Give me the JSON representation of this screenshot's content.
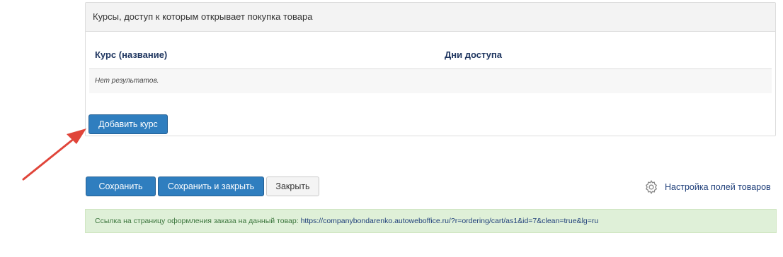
{
  "panel": {
    "title": "Курсы, доступ к которым открывает покупка товара",
    "table": {
      "columns": [
        "Курс (название)",
        "Дни доступа"
      ],
      "empty_text": "Нет результатов."
    },
    "add_button_label": "Добавить курс"
  },
  "actions": {
    "save_label": "Сохранить",
    "save_close_label": "Сохранить и закрыть",
    "close_label": "Закрыть"
  },
  "settings_link": {
    "label": "Настройка полей товаров",
    "icon": "gear-icon"
  },
  "info": {
    "prefix": "Ссылка на страницу оформления заказа на данный товар:",
    "url": "https://companybondarenko.autoweboffice.ru/?r=ordering/cart/as1&id=7&clean=true&lg=ru"
  },
  "colors": {
    "primary_button": "#2f7ebf",
    "arrow": "#e0453a",
    "info_background": "#dff0d8"
  }
}
